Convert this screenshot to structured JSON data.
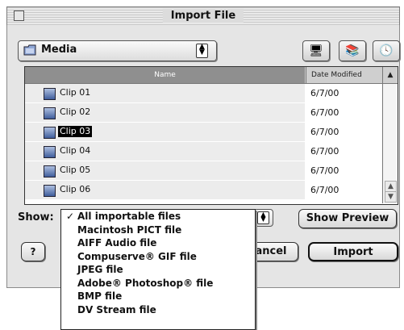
{
  "window": {
    "title": "Import File"
  },
  "folder_popup": {
    "label": "Media",
    "icon": "folder-icon"
  },
  "toolbar_icons": [
    {
      "name": "computer-shortcut-icon",
      "glyph": "🖥"
    },
    {
      "name": "favorites-icon",
      "glyph": "📚"
    },
    {
      "name": "recent-items-icon",
      "glyph": "🕓"
    }
  ],
  "file_list": {
    "columns": {
      "name": "Name",
      "date": "Date Modified",
      "sort_glyph": "▲"
    },
    "rows": [
      {
        "name": "Clip 01",
        "date": "6/7/00",
        "selected": false
      },
      {
        "name": "Clip 02",
        "date": "6/7/00",
        "selected": false
      },
      {
        "name": "Clip 03",
        "date": "6/7/00",
        "selected": true
      },
      {
        "name": "Clip 04",
        "date": "6/7/00",
        "selected": false
      },
      {
        "name": "Clip 05",
        "date": "6/7/00",
        "selected": false
      },
      {
        "name": "Clip 06",
        "date": "6/7/00",
        "selected": false
      }
    ],
    "scroll_up": "▲",
    "scroll_down": "▼"
  },
  "show": {
    "label": "Show:",
    "options": [
      "All importable files",
      "Macintosh PICT file",
      "AIFF Audio file",
      "Compuserve® GIF file",
      "JPEG file",
      "Adobe® Photoshop® file",
      "BMP file",
      "DV Stream file"
    ],
    "selected_index": 0
  },
  "buttons": {
    "show_preview": "Show Preview",
    "help": "?",
    "cancel": "ancel",
    "import": "Import"
  }
}
